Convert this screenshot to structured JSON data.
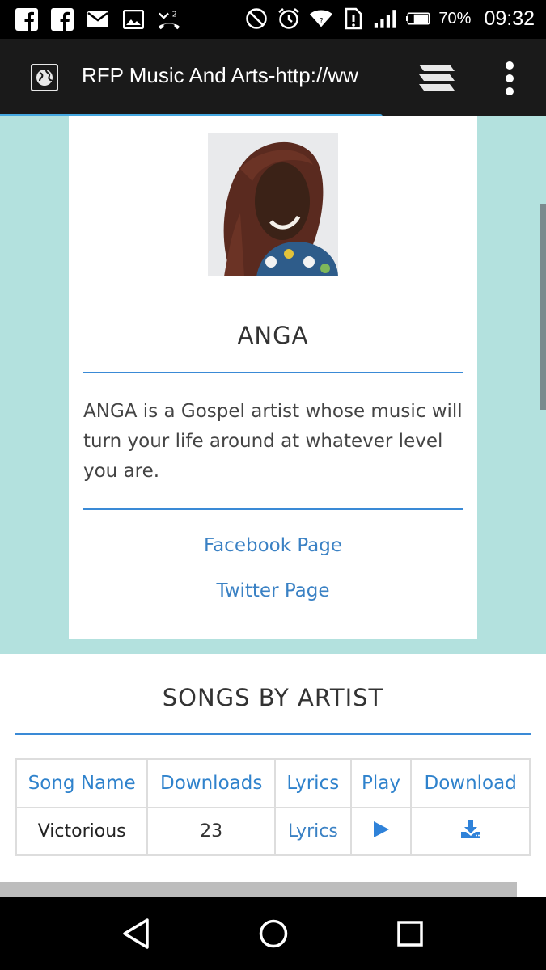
{
  "status_bar": {
    "left_icons": [
      "facebook-icon",
      "facebook-icon",
      "mail-icon",
      "image-icon",
      "missed-call-icon"
    ],
    "battery_percent": "70%",
    "time": "09:32"
  },
  "app_bar": {
    "title": "RFP Music And Arts-http://ww",
    "page_load_progress": 0.7
  },
  "artist": {
    "name": "ANGA",
    "bio": "ANGA is a Gospel artist whose music will turn your life around at whatever level you are.",
    "links": {
      "facebook": "Facebook Page",
      "twitter": "Twitter Page"
    }
  },
  "songs": {
    "title": "SONGS BY ARTIST",
    "headers": {
      "name": "Song Name",
      "downloads": "Downloads",
      "lyrics": "Lyrics",
      "play": "Play",
      "download": "Download"
    },
    "rows": [
      {
        "name": "Victorious",
        "downloads": "23",
        "lyrics": "Lyrics"
      }
    ]
  },
  "colors": {
    "accent": "#3a8ad6",
    "page_background": "#b3e1de",
    "link": "#3a81c4"
  }
}
